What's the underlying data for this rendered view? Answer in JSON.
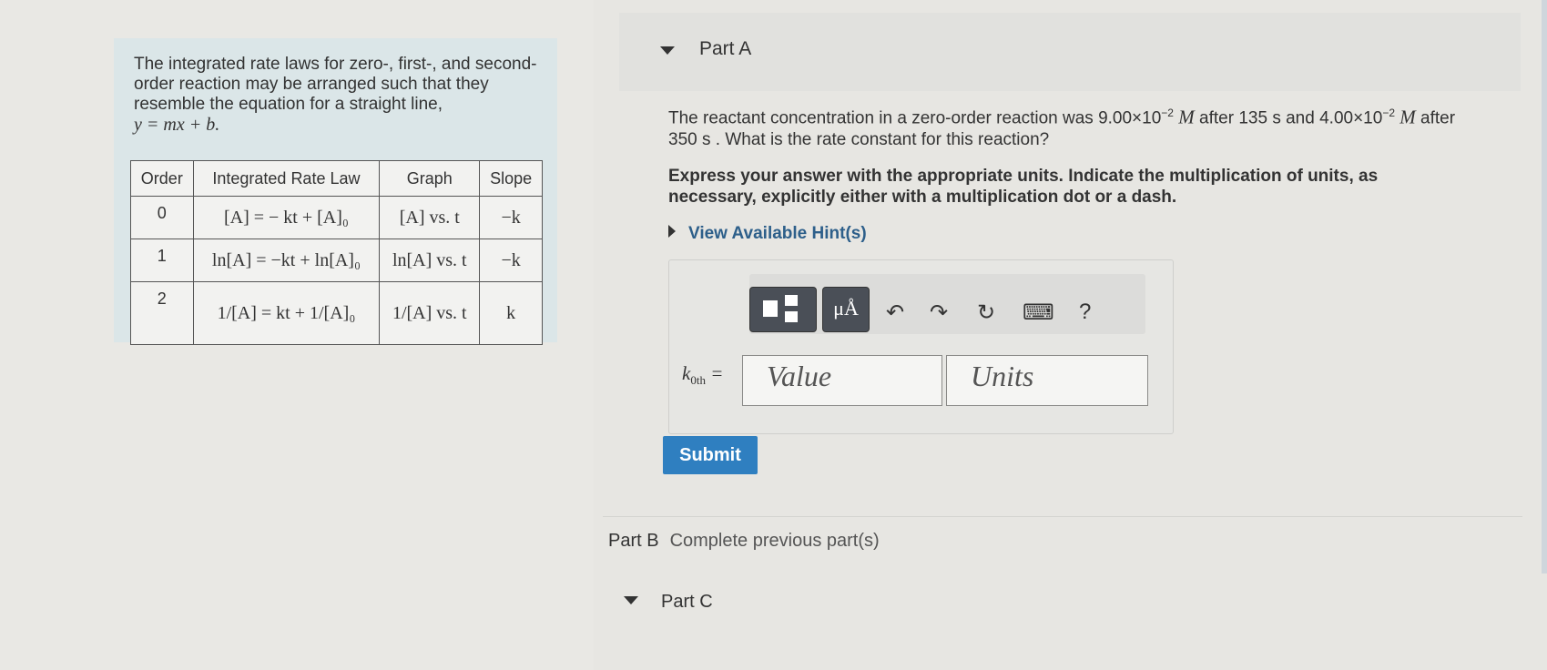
{
  "info": {
    "intro": "The integrated rate laws for zero-, first-, and second-order reaction may be arranged such that they resemble the equation for a straight line,",
    "equation": "y = mx + b.",
    "table": {
      "headers": [
        "Order",
        "Integrated Rate Law",
        "Graph",
        "Slope"
      ],
      "rows": [
        {
          "order": "0",
          "law": "[A] = − kt + [A]₀",
          "graph": "[A] vs. t",
          "slope": "−k"
        },
        {
          "order": "1",
          "law": "ln[A] = −kt + ln[A]₀",
          "graph": "ln[A] vs. t",
          "slope": "−k"
        },
        {
          "order": "2",
          "law": "1/[A] = kt + 1/[A]₀",
          "graph": "1/[A] vs. t",
          "slope": "k"
        }
      ]
    }
  },
  "partA": {
    "title": "Part A",
    "prompt_pre": "The reactant concentration in a zero-order reaction was ",
    "c1": "9.00×10",
    "c1_exp": "−2",
    "unit_M": "M",
    "prompt_mid": " after 135 s and ",
    "c2": "4.00×10",
    "c2_exp": "−2",
    "prompt_post": " after 350 s . What is the rate constant for this reaction?",
    "instructions": "Express your answer with the appropriate units. Indicate the multiplication of units, as necessary, explicitly either with a multiplication dot or a dash.",
    "hint": "View Available Hint(s)",
    "k_label": "k",
    "k_sub": "0th",
    "equals": "=",
    "value_placeholder": "Value",
    "units_placeholder": "Units",
    "toolbar": {
      "units_symbol": "μÅ",
      "help": "?",
      "undo": "↶",
      "redo": "↷",
      "reset": "↻",
      "keyboard": "⌨"
    },
    "submit": "Submit"
  },
  "partB": {
    "title": "Part B",
    "status": "Complete previous part(s)"
  },
  "partC": {
    "title": "Part C"
  }
}
